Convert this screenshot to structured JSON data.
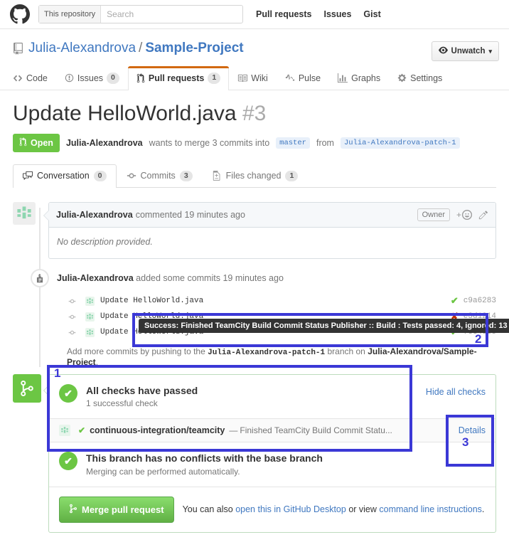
{
  "topnav": {
    "logo_icon": "github-mark-icon",
    "search": {
      "scope": "This repository",
      "placeholder": "Search",
      "value": ""
    },
    "links": [
      {
        "label": "Pull requests",
        "name": "nav-pull-requests"
      },
      {
        "label": "Issues",
        "name": "nav-issues"
      },
      {
        "label": "Gist",
        "name": "nav-gist"
      }
    ]
  },
  "repo": {
    "icon": "repo-icon",
    "owner": "Julia-Alexandrova",
    "separator": "/",
    "name": "Sample-Project",
    "watch_button": {
      "label": "Unwatch",
      "icon": "eye-icon",
      "caret": "▾"
    },
    "tabs": [
      {
        "label": "Code",
        "icon": "code-icon",
        "count": null,
        "selected": false
      },
      {
        "label": "Issues",
        "icon": "issue-opened-icon",
        "count": "0",
        "selected": false
      },
      {
        "label": "Pull requests",
        "icon": "git-pull-request-icon",
        "count": "1",
        "selected": true
      },
      {
        "label": "Wiki",
        "icon": "book-icon",
        "count": null,
        "selected": false
      },
      {
        "label": "Pulse",
        "icon": "pulse-icon",
        "count": null,
        "selected": false
      },
      {
        "label": "Graphs",
        "icon": "graph-icon",
        "count": null,
        "selected": false
      },
      {
        "label": "Settings",
        "icon": "gear-icon",
        "count": null,
        "selected": false
      }
    ]
  },
  "pull_request": {
    "title": "Update HelloWorld.java",
    "number": "#3",
    "state": "Open",
    "state_icon": "git-pull-request-icon",
    "author": "Julia-Alexandrova",
    "merge_text_1": "wants to merge 3 commits into",
    "base_branch": "master",
    "merge_text_2": "from",
    "head_branch": "Julia-Alexandrova-patch-1",
    "tabs": [
      {
        "label": "Conversation",
        "icon": "comment-discussion-icon",
        "count": "0",
        "selected": true
      },
      {
        "label": "Commits",
        "icon": "git-commit-icon",
        "count": "3",
        "selected": false
      },
      {
        "label": "Files changed",
        "icon": "diff-icon",
        "count": "1",
        "selected": false
      }
    ]
  },
  "comment": {
    "avatar": "user-avatar",
    "author": "Julia-Alexandrova",
    "action": "commented 19 minutes ago",
    "owner_badge": "Owner",
    "reaction_icon": "add-reaction-icon",
    "edit_icon": "pencil-icon",
    "body": "No description provided."
  },
  "commits_event": {
    "icon": "repo-push-icon",
    "author": "Julia-Alexandrova",
    "text": "added some commits 19 minutes ago",
    "rows": [
      {
        "message": "Update HelloWorld.java",
        "status": "success",
        "status_glyph": "✔",
        "sha": "c9a6283"
      },
      {
        "message": "Update HelloWorld.java",
        "status": "failure",
        "status_glyph": "✘",
        "sha": "e3d1214"
      },
      {
        "message": "Update HelloWorld.java",
        "status": "success",
        "status_glyph": "✔",
        "sha": "fc849cc"
      }
    ],
    "push_note": {
      "prefix": "Add more commits by pushing to the",
      "branch": "Julia-Alexandrova-patch-1",
      "middle": "branch on",
      "repo": "Julia-Alexandrova/Sample-Project",
      "suffix": "."
    }
  },
  "tooltip": {
    "text": "Success: Finished TeamCity Build Commit Status Publisher :: Build : Tests passed: 4, ignored: 13"
  },
  "merge_box": {
    "avatar_icon": "git-merge-icon",
    "checks": {
      "tick": "✔",
      "title": "All checks have passed",
      "subtitle": "1 successful check",
      "hide_link": "Hide all checks"
    },
    "check_item": {
      "avatar": "teamcity-avatar",
      "tick": "✔",
      "context": "continuous-integration/teamcity",
      "dash": "—",
      "description": "Finished TeamCity Build Commit Statu...",
      "details_link": "Details"
    },
    "conflicts": {
      "tick": "✔",
      "title": "This branch has no conflicts with the base branch",
      "subtitle": "Merging can be performed automatically."
    },
    "footer": {
      "merge_button": "Merge pull request",
      "merge_button_icon": "git-merge-icon",
      "text_1": "You can also",
      "link_1": "open this in GitHub Desktop",
      "text_2": "or view",
      "link_2": "command line instructions",
      "text_3": "."
    }
  },
  "annotations": [
    {
      "label": "1",
      "target": "all-checks-passed-box"
    },
    {
      "label": "2",
      "target": "commit-status-tooltip"
    },
    {
      "label": "3",
      "target": "details-link"
    }
  ],
  "colors": {
    "accent_blue": "#4078c0",
    "green": "#6cc644",
    "red": "#bd2c00",
    "orange": "#d26911",
    "annotation": "#3b38d6"
  }
}
